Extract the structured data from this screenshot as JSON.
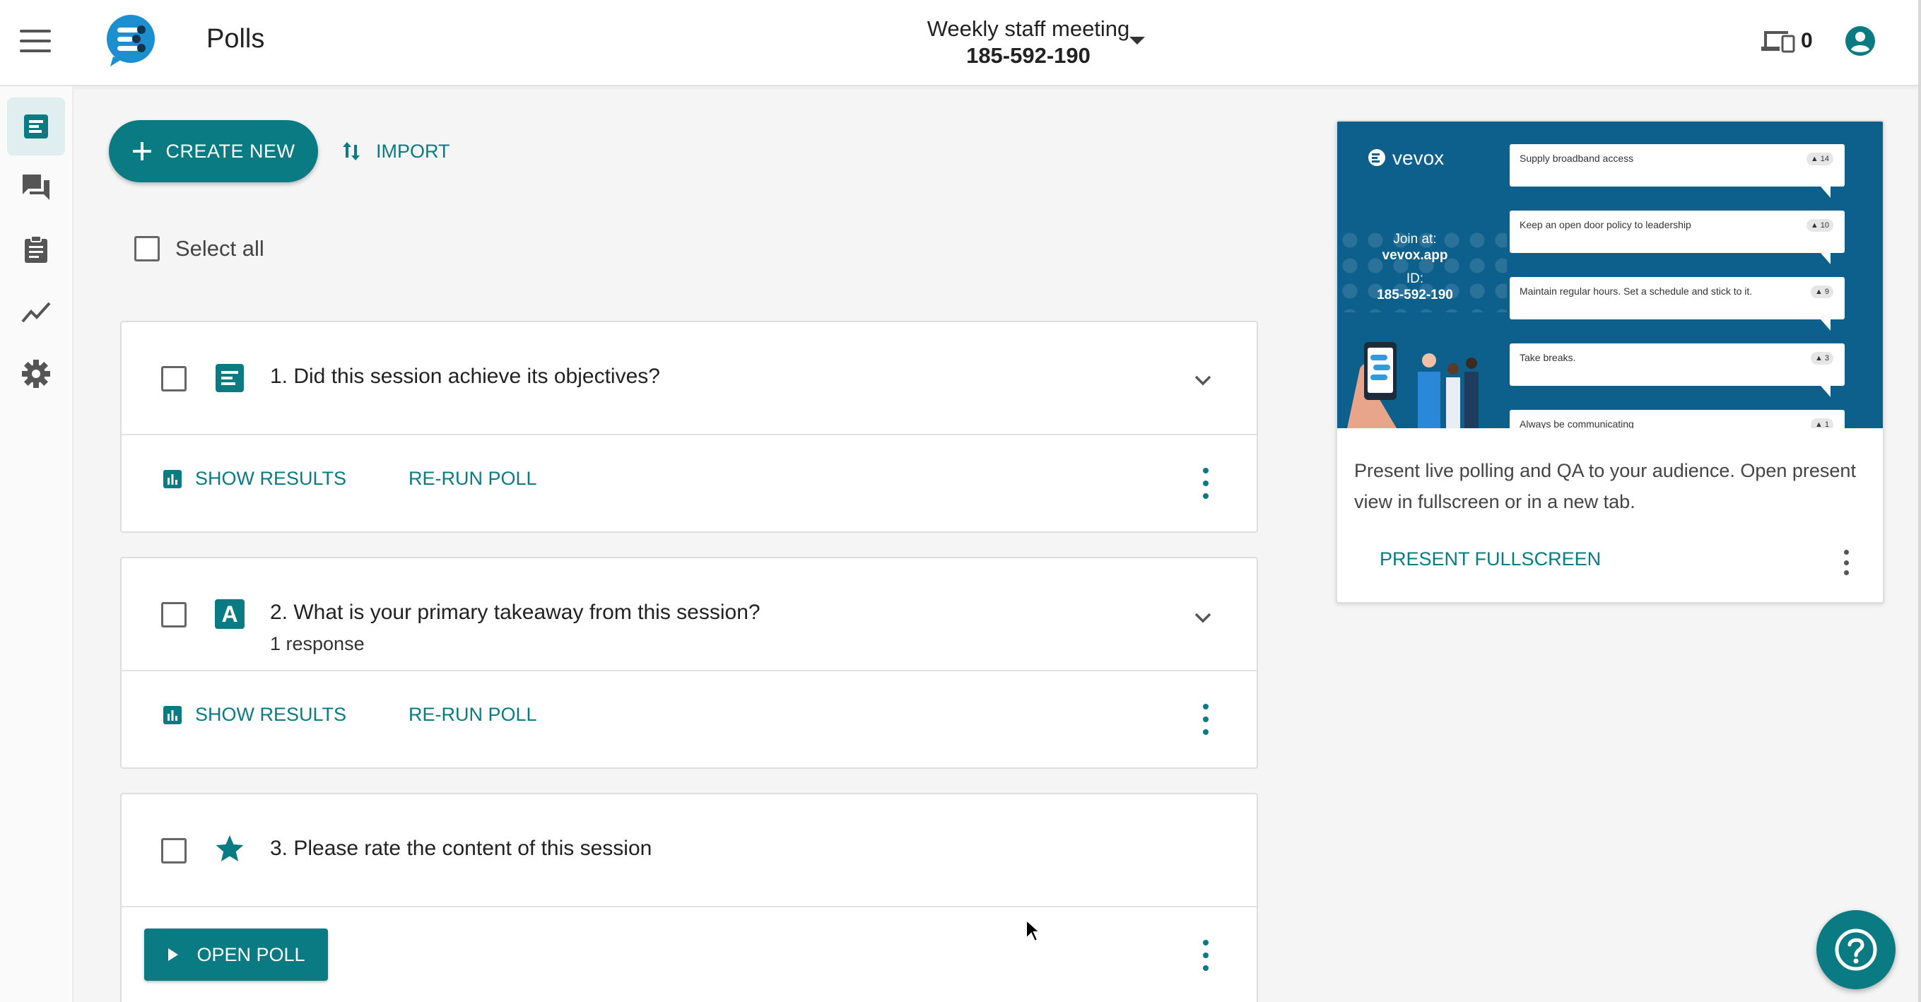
{
  "header": {
    "title": "Polls",
    "session_name": "Weekly staff meeting",
    "session_id": "185-592-190",
    "device_count": "0"
  },
  "toolbar": {
    "create_label": "CREATE NEW",
    "import_label": "IMPORT",
    "select_all_label": "Select all"
  },
  "polls": [
    {
      "title": "1. Did this session achieve its objectives?",
      "subtitle": "",
      "type_icon": "short-text-icon",
      "show_results_label": "SHOW RESULTS",
      "rerun_label": "RE-RUN POLL"
    },
    {
      "title": "2. What is your primary takeaway from this session?",
      "subtitle": "1 response",
      "type_icon": "text-a-icon",
      "type_letter": "A",
      "show_results_label": "SHOW RESULTS",
      "rerun_label": "RE-RUN POLL"
    },
    {
      "title": "3. Please rate the content of this session",
      "subtitle": "",
      "type_icon": "star-icon",
      "open_label": "OPEN POLL"
    }
  ],
  "present": {
    "preview": {
      "brand": "vevox",
      "join_label": "Join at:",
      "join_url": "vevox.app",
      "id_label": "ID:",
      "id_value": "185-592-190",
      "ideas": [
        {
          "text": "Supply broadband access",
          "votes": "14"
        },
        {
          "text": "Keep an open door policy to leadership",
          "votes": "10"
        },
        {
          "text": "Maintain regular hours. Set a schedule and stick to it.",
          "votes": "9"
        },
        {
          "text": "Take breaks.",
          "votes": "3"
        },
        {
          "text": "Always be communicating",
          "votes": "1"
        }
      ]
    },
    "description": "Present live polling and QA to your audience. Open present view in fullscreen or in a new tab.",
    "fullscreen_label": "PRESENT FULLSCREEN"
  },
  "colors": {
    "accent": "#0a7b83",
    "preview_bg": "#0d5f8c"
  }
}
